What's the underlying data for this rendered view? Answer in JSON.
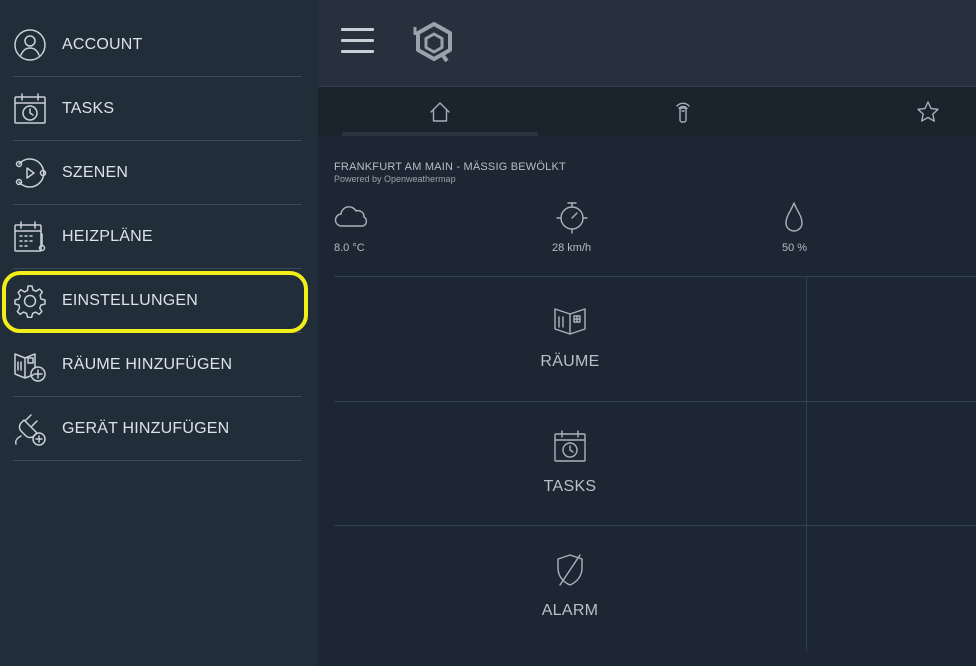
{
  "sidebar": {
    "items": [
      {
        "label": "ACCOUNT",
        "icon": "user-icon"
      },
      {
        "label": "TASKS",
        "icon": "calendar-clock-icon"
      },
      {
        "label": "SZENEN",
        "icon": "scenes-icon"
      },
      {
        "label": "HEIZPLÄNE",
        "icon": "calendar-thermometer-icon"
      },
      {
        "label": "EINSTELLUNGEN",
        "icon": "gear-icon"
      },
      {
        "label": "RÄUME HINZUFÜGEN",
        "icon": "room-add-icon"
      },
      {
        "label": "GERÄT HINZUFÜGEN",
        "icon": "plug-add-icon"
      }
    ],
    "highlighted_item": "EINSTELLUNGEN",
    "highlight_color": "#f2ee1a"
  },
  "topbar": {
    "menu_icon": "hamburger-menu-icon",
    "logo_icon": "iq-logo-icon"
  },
  "tabs": [
    {
      "icon": "home-icon",
      "active": true
    },
    {
      "icon": "remote-signal-icon",
      "active": false
    },
    {
      "icon": "star-icon",
      "active": false
    }
  ],
  "weather": {
    "title": "FRANKFURT AM MAIN - MÄSSIG BEWÖLKT",
    "subtitle": "Powered by Openweathermap",
    "temperature": "8.0 °C",
    "wind": "28 km/h",
    "humidity": "50 %"
  },
  "tiles": [
    {
      "label": "RÄUME",
      "icon": "room-icon"
    },
    {
      "label": "TASKS",
      "icon": "calendar-clock-icon"
    },
    {
      "label": "ALARM",
      "icon": "shield-off-icon"
    }
  ],
  "colors": {
    "background": "#1d2733",
    "sidebar": "#222d3a",
    "topbar": "#26313d"
  }
}
